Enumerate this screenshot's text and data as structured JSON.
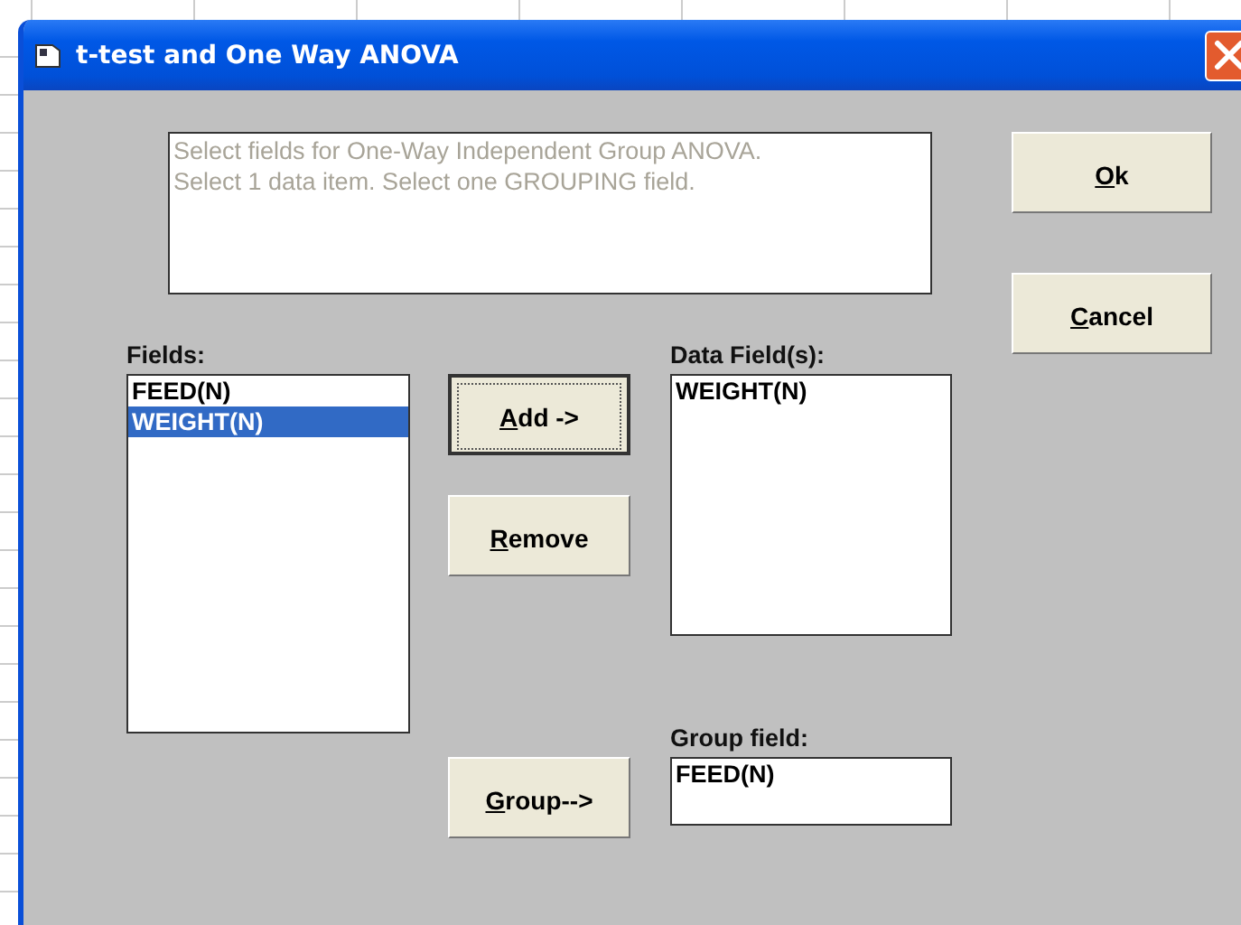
{
  "window": {
    "title": "t-test and One Way ANOVA"
  },
  "instructions": [
    "Select fields for One-Way Independent Group ANOVA.",
    "Select 1 data item. Select one GROUPING field."
  ],
  "fields": {
    "label": "Fields:",
    "items": [
      {
        "text": "FEED(N)",
        "selected": false
      },
      {
        "text": "WEIGHT(N)",
        "selected": true
      }
    ]
  },
  "data_fields": {
    "label": "Data Field(s):",
    "items": [
      "WEIGHT(N)"
    ]
  },
  "group_field": {
    "label": "Group field:",
    "value": "FEED(N)"
  },
  "buttons": [
    {
      "label": "Ok",
      "focused": false
    },
    {
      "label": "Cancel",
      "focused": false
    },
    {
      "label": "Add ->",
      "focused": true
    },
    {
      "label": "Remove",
      "focused": false
    },
    {
      "label": "Group-->",
      "focused": false
    }
  ]
}
